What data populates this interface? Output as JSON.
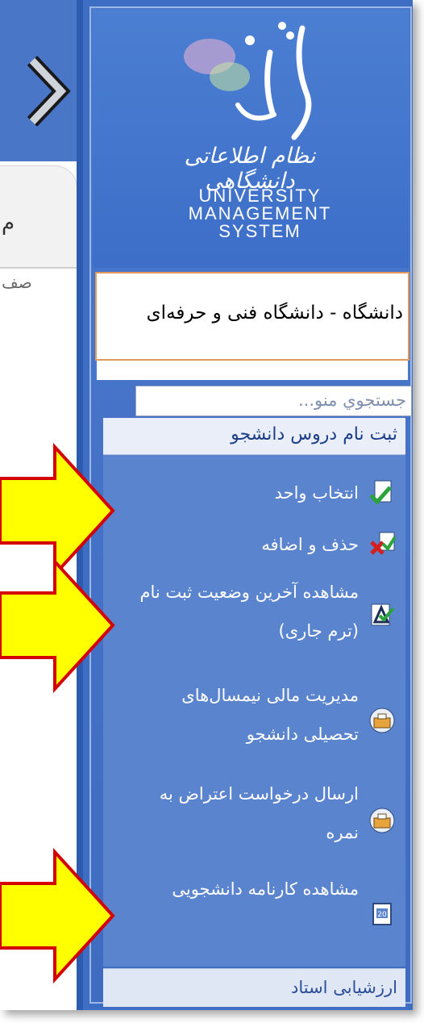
{
  "colors": {
    "sidebar": "#3e6ec4",
    "menu": "#5b84cf",
    "arrow_fill": "#ffff00",
    "arrow_stroke": "#d40000"
  },
  "logo": {
    "script": "ناد",
    "subtitle": "نظام اطلاعاتی دانشگاهی",
    "en_lines": [
      "UNIVERSITY",
      "MANAGEMENT",
      "SYSTEM"
    ]
  },
  "university": {
    "name": "دانشگاه - دانشگاه فنی و حرفه‌ای"
  },
  "search": {
    "placeholder": "جستجوي منو..."
  },
  "left_panel": {
    "tab_char": "م",
    "line_char": "صف"
  },
  "menu": {
    "group_title": "ثبت نام دروس دانشجو",
    "items": [
      {
        "label": "انتخاب واحد",
        "icon": "select-units-icon"
      },
      {
        "label": "حذف و اضافه",
        "icon": "add-drop-icon"
      },
      {
        "label": "مشاهده آخرین وضعیت ثبت نام (ترم جاری)",
        "icon": "registration-status-icon"
      },
      {
        "label": "مدیریت مالی نیمسال‌های تحصیلی دانشجو",
        "icon": "finance-icon"
      },
      {
        "label": "ارسال درخواست اعتراض به نمره",
        "icon": "grade-objection-icon"
      },
      {
        "label": "مشاهده کارنامه دانشجویی",
        "icon": "transcript-icon"
      }
    ],
    "footer_group": "ارزشیابی استاد"
  }
}
